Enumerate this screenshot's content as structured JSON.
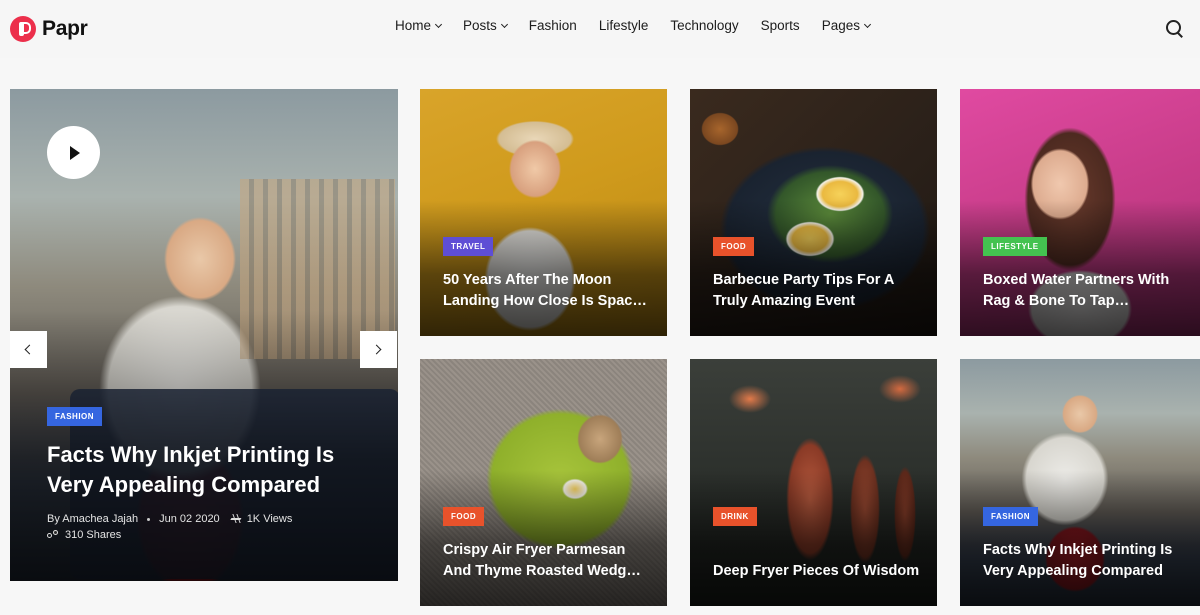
{
  "brand": {
    "name": "Papr",
    "accent": "#ec2f4b"
  },
  "nav": {
    "items": [
      {
        "label": "Home",
        "has_dropdown": true
      },
      {
        "label": "Posts",
        "has_dropdown": true
      },
      {
        "label": "Fashion",
        "has_dropdown": false
      },
      {
        "label": "Lifestyle",
        "has_dropdown": false
      },
      {
        "label": "Technology",
        "has_dropdown": false
      },
      {
        "label": "Sports",
        "has_dropdown": false
      },
      {
        "label": "Pages",
        "has_dropdown": true
      }
    ],
    "search_icon": "search-icon"
  },
  "hero": {
    "category": "FASHION",
    "title": "Facts Why Inkjet Printing Is Very Appealing Compared",
    "author": "By Amachea Jajah",
    "date": "Jun 02 2020",
    "views": "1K Views",
    "shares": "310 Shares"
  },
  "cards": [
    {
      "category": "TRAVEL",
      "title": "50 Years After The Moon Landing How Close Is Spac…",
      "badge_color": "#5e4ed5"
    },
    {
      "category": "FOOD",
      "title": "Barbecue Party Tips For A Truly Amazing Event",
      "badge_color": "#e8522b"
    },
    {
      "category": "LIFESTYLE",
      "title": "Boxed Water Partners With Rag & Bone To Tap…",
      "badge_color": "#44c250"
    },
    {
      "category": "FOOD",
      "title": "Crispy Air Fryer Parmesan And Thyme Roasted Wedg…",
      "badge_color": "#e8522b"
    },
    {
      "category": "DRINK",
      "title": "Deep Fryer Pieces Of Wisdom",
      "badge_color": "#e8522b"
    },
    {
      "category": "FASHION",
      "title": "Facts Why Inkjet Printing Is Very Appealing Compared",
      "badge_color": "#3566e0"
    }
  ]
}
